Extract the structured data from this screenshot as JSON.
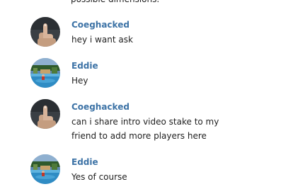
{
  "chat": {
    "clipped_previous_text": "possible dimensions.",
    "messages": [
      {
        "author": "Coeghacked",
        "text": "hey i want ask",
        "avatar": "middle-finger-avatar-icon"
      },
      {
        "author": "Eddie",
        "text": "Hey",
        "avatar": "pool-photo-avatar-icon"
      },
      {
        "author": "Coeghacked",
        "text": "can i share intro video stake to my friend to add more players here",
        "avatar": "middle-finger-avatar-icon"
      },
      {
        "author": "Eddie",
        "text": "Yes of course",
        "avatar": "pool-photo-avatar-icon"
      }
    ]
  },
  "colors": {
    "author_name": "#3d73a6",
    "message_text": "#1f1f1f",
    "background": "#ffffff"
  }
}
